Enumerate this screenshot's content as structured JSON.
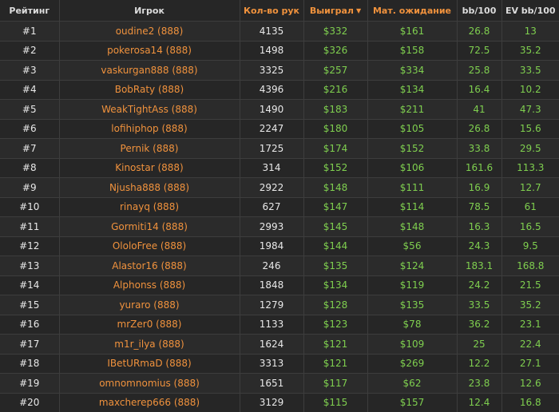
{
  "colors": {
    "accent": "#f0923d",
    "positive": "#7fcf4f",
    "background": "#262626",
    "text": "#e8e8e8"
  },
  "headers": {
    "rank": "Рейтинг",
    "player": "Игрок",
    "hands": "Кол-во рук",
    "won": "Выиграл",
    "won_sort_icon": "sort-desc-icon",
    "ev": "Мат. ожидание",
    "bb100": "bb/100",
    "ev_bb100": "EV bb/100"
  },
  "rows": [
    {
      "rank": "#1",
      "player": "oudine2 (888)",
      "hands": "4135",
      "won": "$332",
      "ev": "$161",
      "bb100": "26.8",
      "ev_bb100": "13"
    },
    {
      "rank": "#2",
      "player": "pokerosa14 (888)",
      "hands": "1498",
      "won": "$326",
      "ev": "$158",
      "bb100": "72.5",
      "ev_bb100": "35.2"
    },
    {
      "rank": "#3",
      "player": "vaskurgan888 (888)",
      "hands": "3325",
      "won": "$257",
      "ev": "$334",
      "bb100": "25.8",
      "ev_bb100": "33.5"
    },
    {
      "rank": "#4",
      "player": "BobRaty (888)",
      "hands": "4396",
      "won": "$216",
      "ev": "$134",
      "bb100": "16.4",
      "ev_bb100": "10.2"
    },
    {
      "rank": "#5",
      "player": "WeakTightAss (888)",
      "hands": "1490",
      "won": "$183",
      "ev": "$211",
      "bb100": "41",
      "ev_bb100": "47.3"
    },
    {
      "rank": "#6",
      "player": "lofihiphop (888)",
      "hands": "2247",
      "won": "$180",
      "ev": "$105",
      "bb100": "26.8",
      "ev_bb100": "15.6"
    },
    {
      "rank": "#7",
      "player": "Pernik (888)",
      "hands": "1725",
      "won": "$174",
      "ev": "$152",
      "bb100": "33.8",
      "ev_bb100": "29.5"
    },
    {
      "rank": "#8",
      "player": "Kinostar (888)",
      "hands": "314",
      "won": "$152",
      "ev": "$106",
      "bb100": "161.6",
      "ev_bb100": "113.3"
    },
    {
      "rank": "#9",
      "player": "Njusha888 (888)",
      "hands": "2922",
      "won": "$148",
      "ev": "$111",
      "bb100": "16.9",
      "ev_bb100": "12.7"
    },
    {
      "rank": "#10",
      "player": "rinayq (888)",
      "hands": "627",
      "won": "$147",
      "ev": "$114",
      "bb100": "78.5",
      "ev_bb100": "61"
    },
    {
      "rank": "#11",
      "player": "Gormiti14 (888)",
      "hands": "2993",
      "won": "$145",
      "ev": "$148",
      "bb100": "16.3",
      "ev_bb100": "16.5"
    },
    {
      "rank": "#12",
      "player": "OloloFree (888)",
      "hands": "1984",
      "won": "$144",
      "ev": "$56",
      "bb100": "24.3",
      "ev_bb100": "9.5"
    },
    {
      "rank": "#13",
      "player": "Alastor16 (888)",
      "hands": "246",
      "won": "$135",
      "ev": "$124",
      "bb100": "183.1",
      "ev_bb100": "168.8"
    },
    {
      "rank": "#14",
      "player": "Alphonss (888)",
      "hands": "1848",
      "won": "$134",
      "ev": "$119",
      "bb100": "24.2",
      "ev_bb100": "21.5"
    },
    {
      "rank": "#15",
      "player": "yuraro (888)",
      "hands": "1279",
      "won": "$128",
      "ev": "$135",
      "bb100": "33.5",
      "ev_bb100": "35.2"
    },
    {
      "rank": "#16",
      "player": "mrZer0 (888)",
      "hands": "1133",
      "won": "$123",
      "ev": "$78",
      "bb100": "36.2",
      "ev_bb100": "23.1"
    },
    {
      "rank": "#17",
      "player": "m1r_ilya (888)",
      "hands": "1624",
      "won": "$121",
      "ev": "$109",
      "bb100": "25",
      "ev_bb100": "22.4"
    },
    {
      "rank": "#18",
      "player": "IBetURmaD (888)",
      "hands": "3313",
      "won": "$121",
      "ev": "$269",
      "bb100": "12.2",
      "ev_bb100": "27.1"
    },
    {
      "rank": "#19",
      "player": "omnomnomius (888)",
      "hands": "1651",
      "won": "$117",
      "ev": "$62",
      "bb100": "23.8",
      "ev_bb100": "12.6"
    },
    {
      "rank": "#20",
      "player": "maxcherep666 (888)",
      "hands": "3129",
      "won": "$115",
      "ev": "$157",
      "bb100": "12.4",
      "ev_bb100": "16.8"
    }
  ]
}
